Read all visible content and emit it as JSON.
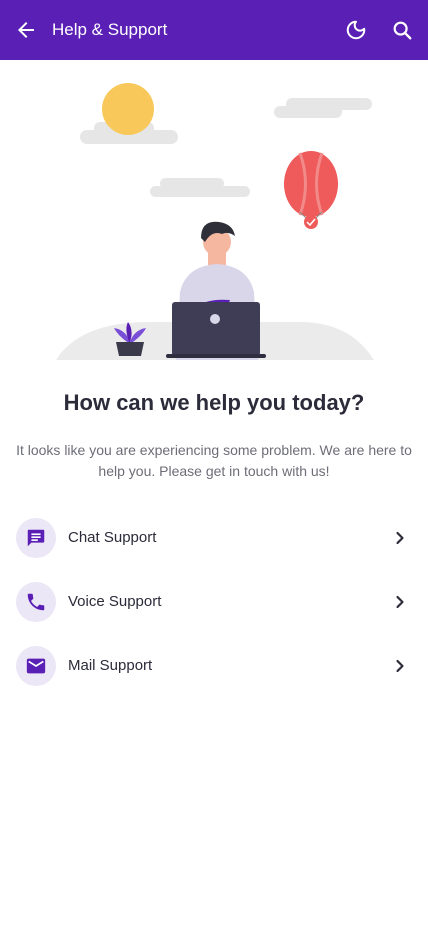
{
  "header": {
    "title": "Help & Support",
    "bg_color": "#5a1fb4",
    "icons": [
      "arrow-back-icon",
      "moon-icon",
      "search-icon"
    ]
  },
  "main": {
    "heading": "How can we help you today?",
    "subtext": "It looks like you are experiencing some problem. We are here to help you. Please get in touch with us!"
  },
  "support_options": [
    {
      "label": "Chat Support",
      "icon": "chat-icon"
    },
    {
      "label": "Voice Support",
      "icon": "phone-icon"
    },
    {
      "label": "Mail Support",
      "icon": "mail-icon"
    }
  ],
  "colors": {
    "accent": "#5a1fb4",
    "icon_circle_bg": "#ece7f6",
    "sun": "#f8c95a",
    "balloon": "#ef5a5a"
  }
}
